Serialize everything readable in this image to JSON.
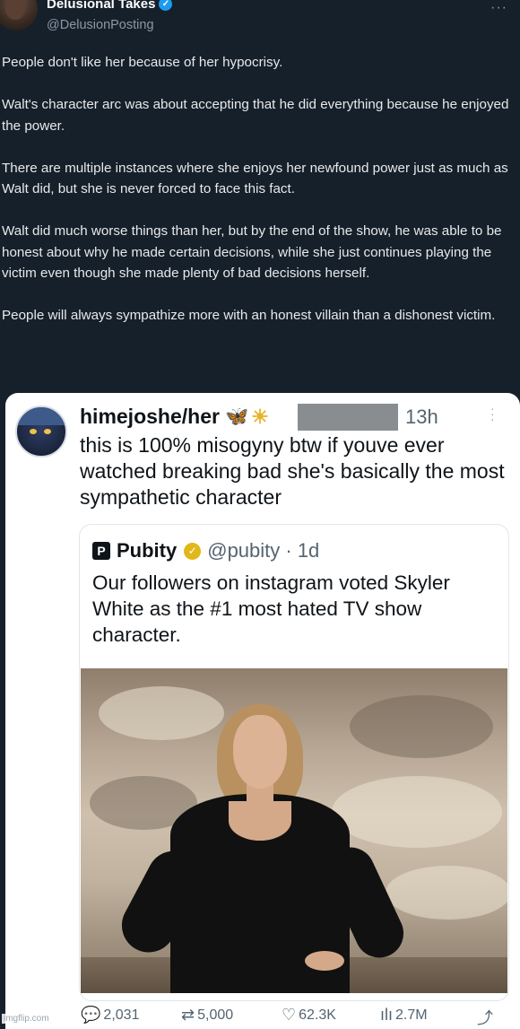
{
  "tweet": {
    "display_name": "Delusional Takes",
    "handle": "@DelusionPosting",
    "more_label": "···",
    "paragraphs": [
      "People don't like her because of her hypocrisy.",
      "Walt's character arc was about accepting that he did everything because he enjoyed the power.",
      "There are multiple instances where she enjoys her newfound power just as much as Walt did, but she is never forced to face this fact.",
      "Walt did much worse things than her, but by the end of the show, he was able to be honest about why he made certain decisions, while she just continues playing the victim even though she made plenty of bad decisions herself.",
      "People will always sympathize more with an honest villain than a dishonest victim."
    ]
  },
  "embedded_tweet": {
    "display_name": "himejoshe/her",
    "time": "13h",
    "text": "this is 100% misogyny btw if youve ever watched breaking bad she's basically the most sympathetic character",
    "quote": {
      "logo_letter": "P",
      "name": "Pubity",
      "handle": "@pubity · 1d",
      "text": "Our followers on instagram voted Skyler White as the #1 most hated TV show character."
    },
    "actions": {
      "replies": "2,031",
      "retweets": "5,000",
      "likes": "62.3K",
      "views": "2.7M"
    }
  },
  "watermark": "imgflip.com",
  "icons": [
    "verified-badge-icon",
    "more-icon",
    "butterfly-icon",
    "sun-icon",
    "gold-check-icon",
    "reply-icon",
    "retweet-icon",
    "like-icon",
    "views-icon",
    "share-icon"
  ],
  "colors": {
    "background": "#15202b",
    "accent": "#1d9bf0",
    "card": "#ffffff",
    "muted": "#536471"
  }
}
